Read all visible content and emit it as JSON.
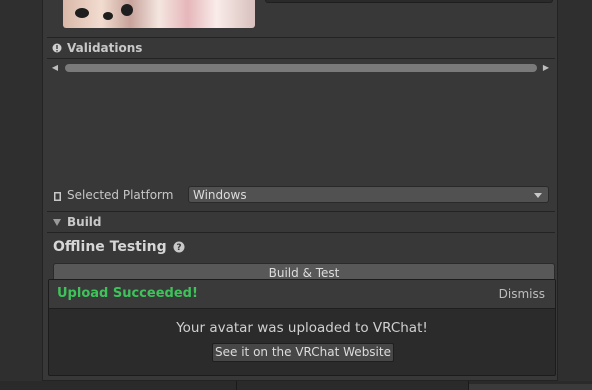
{
  "avatar": {
    "thumbnail_icon": "avatar-thumbnail"
  },
  "validations": {
    "header_label": "Validations",
    "icon": "info-icon",
    "scroll_left_icon": "arrow-left-icon",
    "scroll_right_icon": "arrow-right-icon"
  },
  "platform": {
    "label": "Selected Platform",
    "icon": "platform-icon",
    "value": "Windows"
  },
  "build": {
    "header_label": "Build",
    "icon": "triangle-down-icon",
    "offline_title": "Offline Testing",
    "help_icon": "help-icon",
    "build_test_label": "Build & Test"
  },
  "notification": {
    "status": "Upload Succeeded!",
    "dismiss_label": "Dismiss",
    "message": "Your avatar was uploaded to VRChat!",
    "website_button_label": "See it on the VRChat Website",
    "status_color": "#3ec35a"
  }
}
